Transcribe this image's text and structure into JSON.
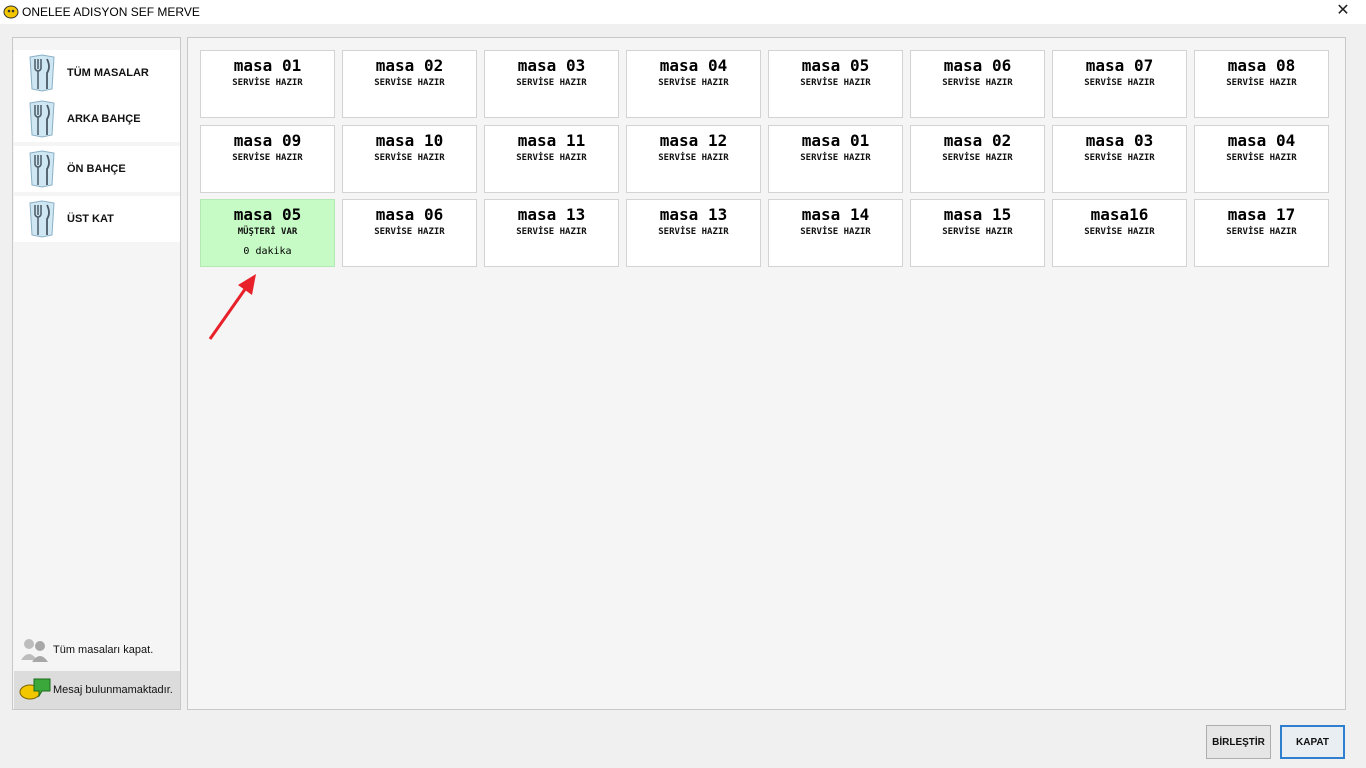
{
  "window": {
    "title": "ONELEE ADISYON SEF MERVE",
    "close_glyph": "✕"
  },
  "sidebar": {
    "categories": [
      {
        "label": "TÜM MASALAR",
        "icon": "cutlery-icon"
      },
      {
        "label": "ARKA BAHÇE",
        "icon": "cutlery-icon"
      },
      {
        "label": "ÖN BAHÇE",
        "icon": "cutlery-icon"
      },
      {
        "label": "ÜST KAT",
        "icon": "cutlery-icon"
      }
    ],
    "close_all_label": "Tüm masaları kapat.",
    "message_label": "Mesaj bulunmamaktadır."
  },
  "tables": [
    {
      "name": "masa 01",
      "status": "SERVİSE HAZIR"
    },
    {
      "name": "masa 02",
      "status": "SERVİSE HAZIR"
    },
    {
      "name": "masa 03",
      "status": "SERVİSE HAZIR"
    },
    {
      "name": "masa 04",
      "status": "SERVİSE HAZIR"
    },
    {
      "name": "masa 05",
      "status": "SERVİSE HAZIR"
    },
    {
      "name": "masa 06",
      "status": "SERVİSE HAZIR"
    },
    {
      "name": "masa 07",
      "status": "SERVİSE HAZIR"
    },
    {
      "name": "masa 08",
      "status": "SERVİSE HAZIR"
    },
    {
      "name": "masa 09",
      "status": "SERVİSE HAZIR"
    },
    {
      "name": "masa 10",
      "status": "SERVİSE HAZIR"
    },
    {
      "name": "masa 11",
      "status": "SERVİSE HAZIR"
    },
    {
      "name": "masa 12",
      "status": "SERVİSE HAZIR"
    },
    {
      "name": "masa 01",
      "status": "SERVİSE HAZIR"
    },
    {
      "name": "masa 02",
      "status": "SERVİSE HAZIR"
    },
    {
      "name": "masa 03",
      "status": "SERVİSE HAZIR"
    },
    {
      "name": "masa 04",
      "status": "SERVİSE HAZIR"
    },
    {
      "name": "masa 05",
      "status": "MÜŞTERİ VAR",
      "time": "0 dakika",
      "busy": true
    },
    {
      "name": "masa 06",
      "status": "SERVİSE HAZIR"
    },
    {
      "name": "masa 13",
      "status": "SERVİSE HAZIR"
    },
    {
      "name": "masa 13",
      "status": "SERVİSE HAZIR"
    },
    {
      "name": "masa 14",
      "status": "SERVİSE HAZIR"
    },
    {
      "name": "masa 15",
      "status": "SERVİSE HAZIR"
    },
    {
      "name": "masa16",
      "status": "SERVİSE HAZIR"
    },
    {
      "name": "masa 17",
      "status": "SERVİSE HAZIR"
    }
  ],
  "buttons": {
    "merge": "BİRLEŞTİR",
    "close": "KAPAT"
  },
  "colors": {
    "busy_table": "#c6fbc6",
    "annotation_arrow": "#e8202a",
    "primary_border": "#2f7fd0"
  }
}
